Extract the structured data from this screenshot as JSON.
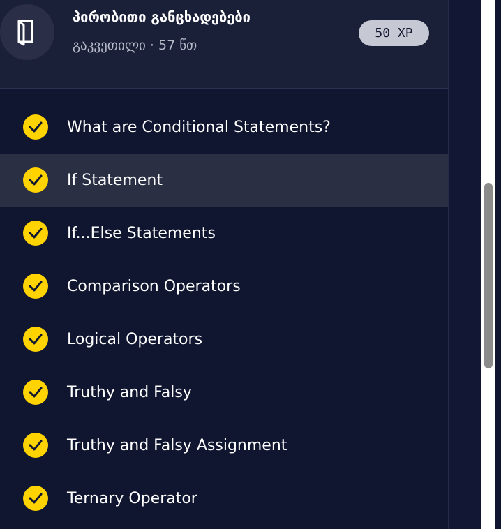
{
  "header": {
    "title": "პირობითი განცხადებები",
    "subtitle": "გაკვეთილი · 57 წთ",
    "xp": "50 XP",
    "icon": "book-icon"
  },
  "lessons": [
    {
      "label": "What are Conditional Statements?",
      "done": true
    },
    {
      "label": "If Statement",
      "done": true,
      "active": true
    },
    {
      "label": "If...Else Statements",
      "done": true
    },
    {
      "label": "Comparison Operators",
      "done": true
    },
    {
      "label": "Logical Operators",
      "done": true
    },
    {
      "label": "Truthy and Falsy",
      "done": true
    },
    {
      "label": "Truthy and Falsy Assignment",
      "done": true
    },
    {
      "label": "Ternary Operator",
      "done": true
    }
  ],
  "colors": {
    "background": "#10162f",
    "header": "#1b2039",
    "active_row": "#2a2f44",
    "check": "#ffd300",
    "badge": "#c6c8d3"
  }
}
